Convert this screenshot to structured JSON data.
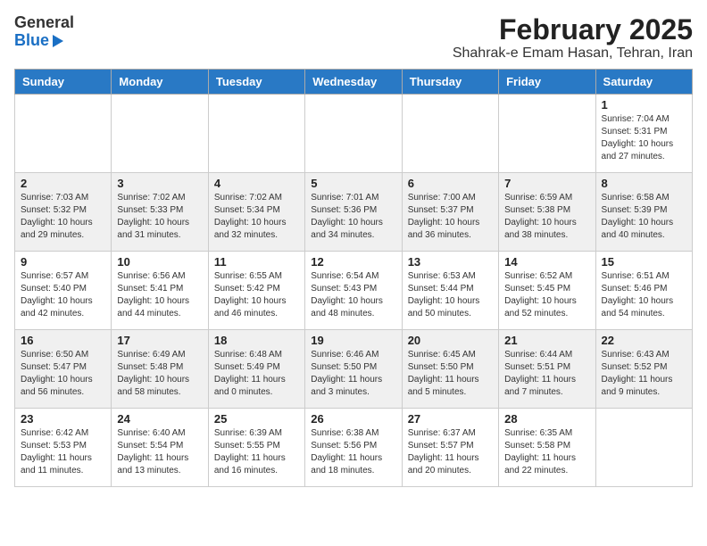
{
  "logo": {
    "general": "General",
    "blue": "Blue"
  },
  "title": {
    "month_year": "February 2025",
    "location": "Shahrak-e Emam Hasan, Tehran, Iran"
  },
  "weekdays": [
    "Sunday",
    "Monday",
    "Tuesday",
    "Wednesday",
    "Thursday",
    "Friday",
    "Saturday"
  ],
  "weeks": [
    [
      {
        "day": "",
        "info": ""
      },
      {
        "day": "",
        "info": ""
      },
      {
        "day": "",
        "info": ""
      },
      {
        "day": "",
        "info": ""
      },
      {
        "day": "",
        "info": ""
      },
      {
        "day": "",
        "info": ""
      },
      {
        "day": "1",
        "info": "Sunrise: 7:04 AM\nSunset: 5:31 PM\nDaylight: 10 hours\nand 27 minutes."
      }
    ],
    [
      {
        "day": "2",
        "info": "Sunrise: 7:03 AM\nSunset: 5:32 PM\nDaylight: 10 hours\nand 29 minutes."
      },
      {
        "day": "3",
        "info": "Sunrise: 7:02 AM\nSunset: 5:33 PM\nDaylight: 10 hours\nand 31 minutes."
      },
      {
        "day": "4",
        "info": "Sunrise: 7:02 AM\nSunset: 5:34 PM\nDaylight: 10 hours\nand 32 minutes."
      },
      {
        "day": "5",
        "info": "Sunrise: 7:01 AM\nSunset: 5:36 PM\nDaylight: 10 hours\nand 34 minutes."
      },
      {
        "day": "6",
        "info": "Sunrise: 7:00 AM\nSunset: 5:37 PM\nDaylight: 10 hours\nand 36 minutes."
      },
      {
        "day": "7",
        "info": "Sunrise: 6:59 AM\nSunset: 5:38 PM\nDaylight: 10 hours\nand 38 minutes."
      },
      {
        "day": "8",
        "info": "Sunrise: 6:58 AM\nSunset: 5:39 PM\nDaylight: 10 hours\nand 40 minutes."
      }
    ],
    [
      {
        "day": "9",
        "info": "Sunrise: 6:57 AM\nSunset: 5:40 PM\nDaylight: 10 hours\nand 42 minutes."
      },
      {
        "day": "10",
        "info": "Sunrise: 6:56 AM\nSunset: 5:41 PM\nDaylight: 10 hours\nand 44 minutes."
      },
      {
        "day": "11",
        "info": "Sunrise: 6:55 AM\nSunset: 5:42 PM\nDaylight: 10 hours\nand 46 minutes."
      },
      {
        "day": "12",
        "info": "Sunrise: 6:54 AM\nSunset: 5:43 PM\nDaylight: 10 hours\nand 48 minutes."
      },
      {
        "day": "13",
        "info": "Sunrise: 6:53 AM\nSunset: 5:44 PM\nDaylight: 10 hours\nand 50 minutes."
      },
      {
        "day": "14",
        "info": "Sunrise: 6:52 AM\nSunset: 5:45 PM\nDaylight: 10 hours\nand 52 minutes."
      },
      {
        "day": "15",
        "info": "Sunrise: 6:51 AM\nSunset: 5:46 PM\nDaylight: 10 hours\nand 54 minutes."
      }
    ],
    [
      {
        "day": "16",
        "info": "Sunrise: 6:50 AM\nSunset: 5:47 PM\nDaylight: 10 hours\nand 56 minutes."
      },
      {
        "day": "17",
        "info": "Sunrise: 6:49 AM\nSunset: 5:48 PM\nDaylight: 10 hours\nand 58 minutes."
      },
      {
        "day": "18",
        "info": "Sunrise: 6:48 AM\nSunset: 5:49 PM\nDaylight: 11 hours\nand 0 minutes."
      },
      {
        "day": "19",
        "info": "Sunrise: 6:46 AM\nSunset: 5:50 PM\nDaylight: 11 hours\nand 3 minutes."
      },
      {
        "day": "20",
        "info": "Sunrise: 6:45 AM\nSunset: 5:50 PM\nDaylight: 11 hours\nand 5 minutes."
      },
      {
        "day": "21",
        "info": "Sunrise: 6:44 AM\nSunset: 5:51 PM\nDaylight: 11 hours\nand 7 minutes."
      },
      {
        "day": "22",
        "info": "Sunrise: 6:43 AM\nSunset: 5:52 PM\nDaylight: 11 hours\nand 9 minutes."
      }
    ],
    [
      {
        "day": "23",
        "info": "Sunrise: 6:42 AM\nSunset: 5:53 PM\nDaylight: 11 hours\nand 11 minutes."
      },
      {
        "day": "24",
        "info": "Sunrise: 6:40 AM\nSunset: 5:54 PM\nDaylight: 11 hours\nand 13 minutes."
      },
      {
        "day": "25",
        "info": "Sunrise: 6:39 AM\nSunset: 5:55 PM\nDaylight: 11 hours\nand 16 minutes."
      },
      {
        "day": "26",
        "info": "Sunrise: 6:38 AM\nSunset: 5:56 PM\nDaylight: 11 hours\nand 18 minutes."
      },
      {
        "day": "27",
        "info": "Sunrise: 6:37 AM\nSunset: 5:57 PM\nDaylight: 11 hours\nand 20 minutes."
      },
      {
        "day": "28",
        "info": "Sunrise: 6:35 AM\nSunset: 5:58 PM\nDaylight: 11 hours\nand 22 minutes."
      },
      {
        "day": "",
        "info": ""
      }
    ]
  ]
}
